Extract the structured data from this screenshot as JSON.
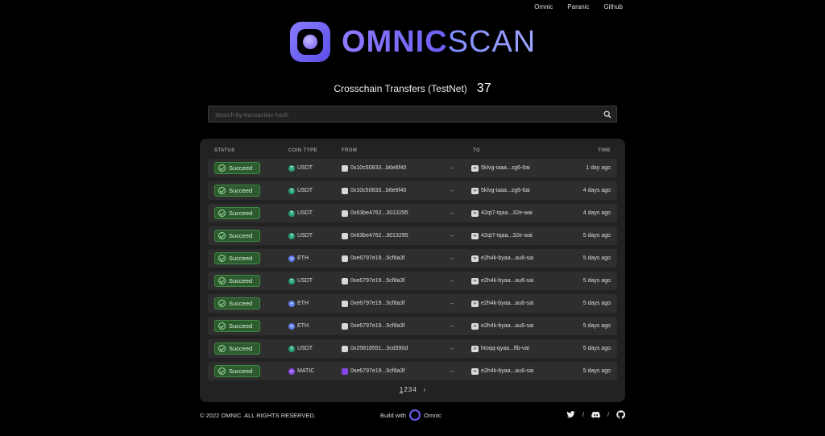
{
  "nav": [
    "Omnic",
    "Paranic",
    "Github"
  ],
  "brand": {
    "bold": "OMNIC",
    "thin": "SCAN"
  },
  "header": {
    "title": "Crosschain Transfers (TestNet)",
    "count": "37"
  },
  "search": {
    "placeholder": "Search by transaction hash"
  },
  "columns": [
    "STATUS",
    "COIN TYPE",
    "FROM",
    "TO",
    "TIME"
  ],
  "rows": [
    {
      "status": "Succeed",
      "coin": "USDT",
      "coin_icon": "tether",
      "from": "0x10c50833...b6e6f40",
      "from_chain": "ethereum",
      "to": "5klvg-iaaa...zg6-6ai",
      "time": "1 day ago"
    },
    {
      "status": "Succeed",
      "coin": "USDT",
      "coin_icon": "tether",
      "from": "0x10c50833...b6e6f40",
      "from_chain": "ethereum",
      "to": "5klvg-iaaa...zg6-6ai",
      "time": "4 days ago"
    },
    {
      "status": "Succeed",
      "coin": "USDT",
      "coin_icon": "tether",
      "from": "0x63be4762...3013295",
      "from_chain": "ethereum",
      "to": "42qt7-tqaa...32e-wai",
      "time": "4 days ago"
    },
    {
      "status": "Succeed",
      "coin": "USDT",
      "coin_icon": "tether",
      "from": "0x63be4762...3013295",
      "from_chain": "ethereum",
      "to": "42qt7-tqaa...32e-wai",
      "time": "5 days ago"
    },
    {
      "status": "Succeed",
      "coin": "ETH",
      "coin_icon": "ethereum",
      "from": "0xe6797e19...5cf8a3f",
      "from_chain": "ethereum",
      "to": "e2h4k-byaa...au6-sai",
      "time": "5 days ago"
    },
    {
      "status": "Succeed",
      "coin": "USDT",
      "coin_icon": "tether",
      "from": "0xe6797e19...5cf8a3f",
      "from_chain": "ethereum",
      "to": "e2h4k-byaa...au6-sai",
      "time": "5 days ago"
    },
    {
      "status": "Succeed",
      "coin": "ETH",
      "coin_icon": "ethereum",
      "from": "0xe6797e19...5cf8a3f",
      "from_chain": "ethereum",
      "to": "e2h4k-byaa...au6-sai",
      "time": "5 days ago"
    },
    {
      "status": "Succeed",
      "coin": "ETH",
      "coin_icon": "ethereum",
      "from": "0xe6797e19...5cf8a3f",
      "from_chain": "ethereum",
      "to": "e2h4k-byaa...au6-sai",
      "time": "5 days ago"
    },
    {
      "status": "Succeed",
      "coin": "USDT",
      "coin_icon": "tether",
      "from": "0x25816551...3cd390d",
      "from_chain": "ethereum",
      "to": "htoqq-qyaa...ftb-vai",
      "time": "5 days ago"
    },
    {
      "status": "Succeed",
      "coin": "MATIC",
      "coin_icon": "polygon",
      "from": "0xe6797e19...5cf8a3f",
      "from_chain": "polygon",
      "to": "e2h4k-byaa...au6-sai",
      "time": "5 days ago"
    }
  ],
  "pagination": {
    "pages": [
      "1",
      "2",
      "3",
      "4"
    ],
    "current": "1",
    "next": "›"
  },
  "footer": {
    "copyright": "© 2022 OMNIC. ALL RIGHTS RESERVED.",
    "build_label": "Build with",
    "build_brand": "Omnic",
    "separator": "/"
  },
  "colors": {
    "accent": "#6c5ff5",
    "success": "#3f8a41",
    "usdt": "#26a17b",
    "eth": "#627eea",
    "matic": "#8247e5"
  }
}
